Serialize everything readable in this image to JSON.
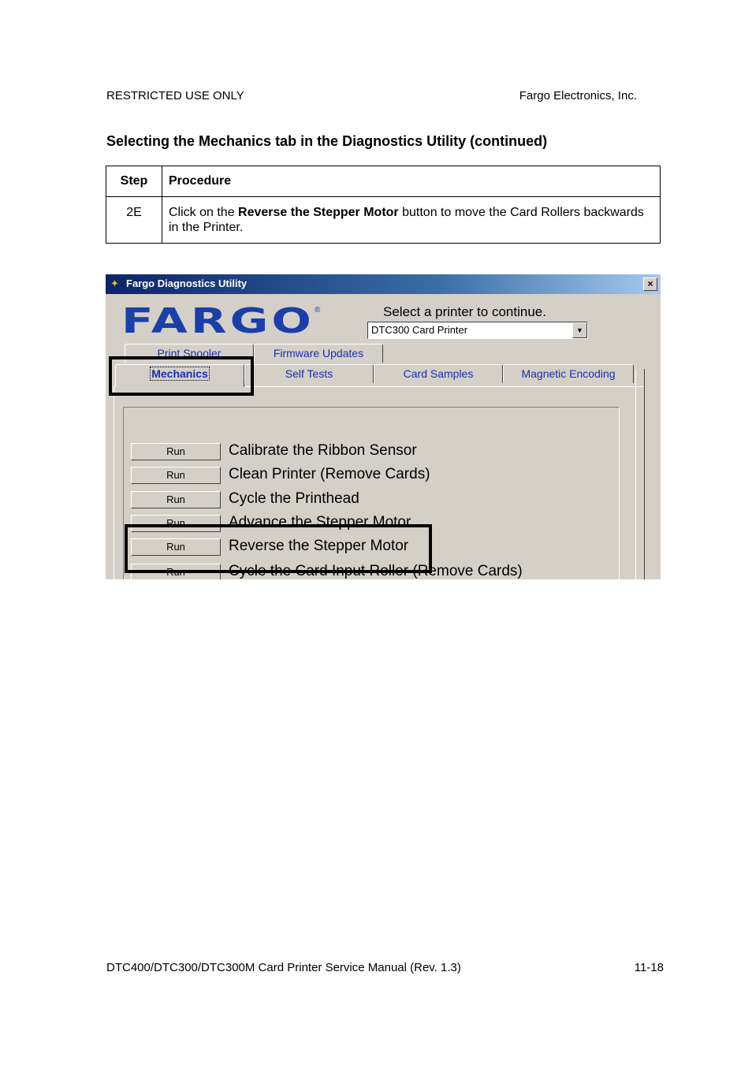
{
  "header": {
    "left": "RESTRICTED USE ONLY",
    "right": "Fargo Electronics, Inc."
  },
  "section_title": "Selecting the Mechanics tab in the Diagnostics Utility (continued)",
  "table": {
    "col_step": "Step",
    "col_procedure": "Procedure",
    "row": {
      "step": "2E",
      "text_before": "Click on the ",
      "text_bold": "Reverse the Stepper Motor",
      "text_after": " button to move the Card Rollers backwards in the Printer."
    }
  },
  "screenshot": {
    "window_title": "Fargo Diagnostics Utility",
    "close_label": "×",
    "logo": "FARGO",
    "logo_mark": "®",
    "select_label": "Select a printer to continue.",
    "select_value": "DTC300 Card Printer",
    "tabs_back": [
      "Print Spooler",
      "Firmware Updates"
    ],
    "tabs_front": [
      "Mechanics",
      "Self Tests",
      "Card Samples",
      "Magnetic Encoding"
    ],
    "run_label": "Run",
    "actions": [
      "Calibrate the Ribbon Sensor",
      "Clean Printer (Remove Cards)",
      "Cycle the Printhead",
      "Advance the Stepper Motor",
      "Reverse the Stepper Motor",
      "Cycle the Card Input Roller (Remove Cards)"
    ]
  },
  "footer": {
    "left": "DTC400/DTC300/DTC300M Card Printer Service Manual (Rev. 1.3)",
    "right": "11-18"
  }
}
